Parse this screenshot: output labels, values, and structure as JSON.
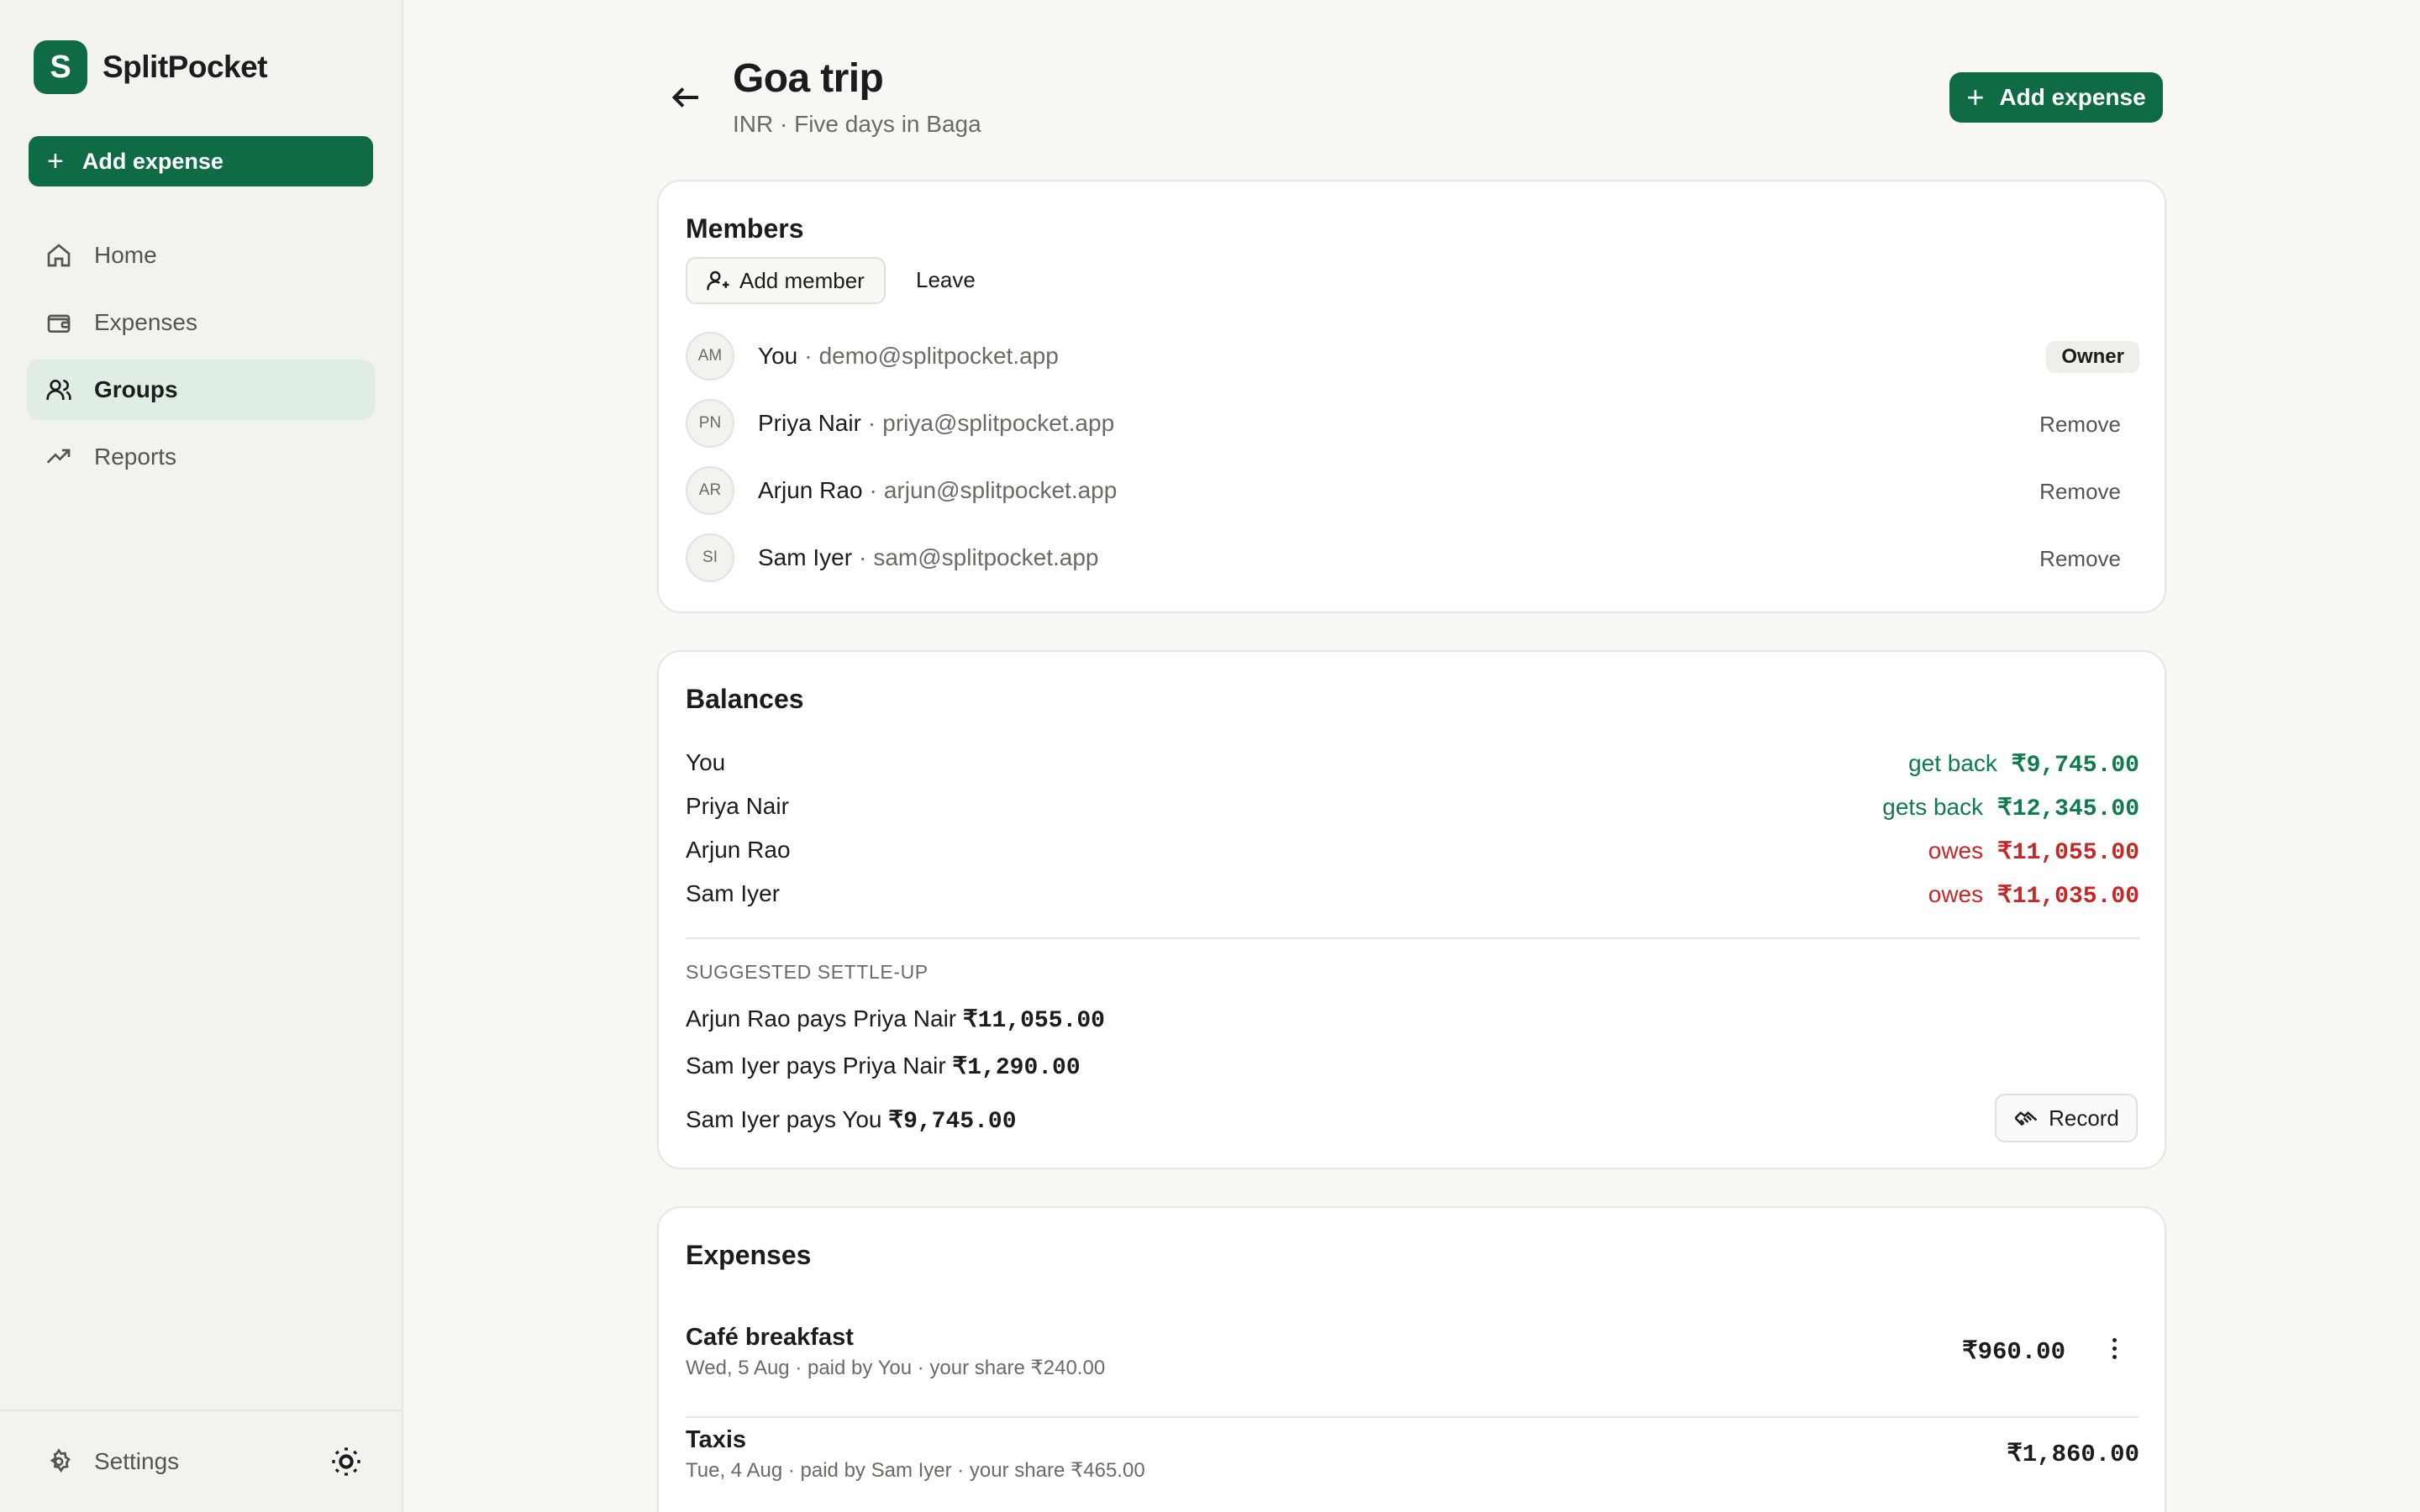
{
  "app": {
    "logo_letter": "S",
    "name": "SplitPocket"
  },
  "sidebar": {
    "add_label": "Add expense",
    "items": [
      {
        "label": "Home",
        "icon": "home-icon"
      },
      {
        "label": "Expenses",
        "icon": "wallet-icon"
      },
      {
        "label": "Groups",
        "icon": "users-icon",
        "active": true
      },
      {
        "label": "Reports",
        "icon": "trending-up-icon"
      }
    ],
    "settings_label": "Settings",
    "theme_icon": "sun-icon"
  },
  "header": {
    "title": "Goa trip",
    "subtitle": "INR · Five days in Baga",
    "add_label": "Add expense"
  },
  "members": {
    "title": "Members",
    "add_label": "Add member",
    "leave_label": "Leave",
    "list": [
      {
        "initials": "AM",
        "name": "You",
        "email": "demo@splitpocket.app",
        "badge": "Owner"
      },
      {
        "initials": "PN",
        "name": "Priya Nair",
        "email": "priya@splitpocket.app",
        "action": "Remove"
      },
      {
        "initials": "AR",
        "name": "Arjun Rao",
        "email": "arjun@splitpocket.app",
        "action": "Remove"
      },
      {
        "initials": "SI",
        "name": "Sam Iyer",
        "email": "sam@splitpocket.app",
        "action": "Remove"
      }
    ]
  },
  "balances": {
    "title": "Balances",
    "rows": [
      {
        "name": "You",
        "verb": "get back",
        "amount": "₹9,745.00",
        "status": "positive"
      },
      {
        "name": "Priya Nair",
        "verb": "gets back",
        "amount": "₹12,345.00",
        "status": "positive"
      },
      {
        "name": "Arjun Rao",
        "verb": "owes",
        "amount": "₹11,055.00",
        "status": "negative"
      },
      {
        "name": "Sam Iyer",
        "verb": "owes",
        "amount": "₹11,035.00",
        "status": "negative"
      }
    ],
    "settle_label": "SUGGESTED SETTLE-UP",
    "settle": [
      {
        "text": "Arjun Rao pays Priya Nair",
        "amount": "₹11,055.00"
      },
      {
        "text": "Sam Iyer pays Priya Nair",
        "amount": "₹1,290.00"
      },
      {
        "text": "Sam Iyer pays You",
        "amount": "₹9,745.00"
      }
    ],
    "record_label": "Record"
  },
  "expenses": {
    "title": "Expenses",
    "list": [
      {
        "name": "Café breakfast",
        "meta": "Wed, 5 Aug · paid by You · your share ₹240.00",
        "amount": "₹960.00"
      },
      {
        "name": "Taxis",
        "meta": "Tue, 4 Aug · paid by Sam Iyer · your share ₹465.00",
        "amount": "₹1,860.00"
      }
    ]
  },
  "colors": {
    "brand": "#0f6b44",
    "positive": "#0f7a4a",
    "negative": "#c62828",
    "active_nav": "#dfede5"
  }
}
